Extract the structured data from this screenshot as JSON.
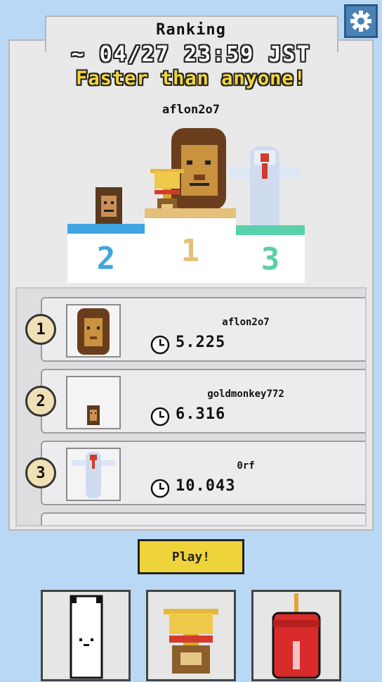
{
  "header": {
    "title": "Ranking",
    "deadline": "~ 04/27 23:59 JST",
    "subtitle": "Faster than anyone!",
    "winner": "aflon2o7"
  },
  "podium": {
    "first": "1",
    "second": "2",
    "third": "3"
  },
  "ranking": [
    {
      "rank": "1",
      "name": "aflon2o7",
      "time": "5.225",
      "icon": "lion-icon"
    },
    {
      "rank": "2",
      "name": "goldmonkey772",
      "time": "6.316",
      "icon": "monkey-icon"
    },
    {
      "rank": "3",
      "name": "0rf",
      "time": "10.043",
      "icon": "angel-bottle-icon"
    }
  ],
  "play_label": "Play!",
  "colors": {
    "background": "#b9d8f5",
    "panel": "#e9e9ea",
    "accent_yellow": "#efd33a",
    "second_blue": "#3fa5e0",
    "first_gold": "#e5c07a",
    "third_teal": "#58d0aa",
    "gear_blue": "#4a82b6"
  },
  "bottom_nav": [
    "cat-icon",
    "trophy-icon",
    "soda-can-icon"
  ]
}
